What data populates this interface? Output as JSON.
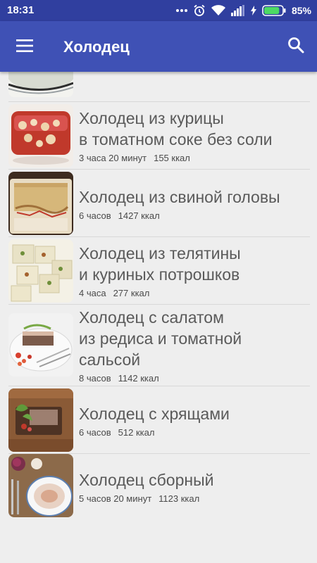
{
  "status_bar": {
    "time": "18:31",
    "battery_percent": "85%",
    "battery_level": 0.85,
    "icons": [
      "more-dots-icon",
      "alarm-icon",
      "wifi-icon",
      "signal-icon",
      "charging-icon",
      "battery-icon"
    ]
  },
  "app_bar": {
    "title": "Холодец",
    "menu_icon": "hamburger-menu-icon",
    "search_icon": "search-icon",
    "color": "#3f51b5",
    "status_color": "#303f9f"
  },
  "recipes": [
    {
      "name_lines": [
        "Холодец из курицы",
        "в томатном соке без соли"
      ],
      "time": "3 часа 20 минут",
      "kcal": "155 ккал"
    },
    {
      "name_lines": [
        "Холодец из свиной головы"
      ],
      "time": "6 часов",
      "kcal": "1427 ккал"
    },
    {
      "name_lines": [
        "Холодец из телятины",
        "и куриных потрошков"
      ],
      "time": "4 часа",
      "kcal": "277 ккал"
    },
    {
      "name_lines": [
        "Холодец с салатом",
        "из редиса и томатной",
        "сальсой"
      ],
      "time": "8 часов",
      "kcal": "1142 ккал"
    },
    {
      "name_lines": [
        "Холодец с хрящами"
      ],
      "time": "6 часов",
      "kcal": "512 ккал"
    },
    {
      "name_lines": [
        "Холодец сборный"
      ],
      "time": "5 часов 20 минут",
      "kcal": "1123 ккал"
    }
  ]
}
